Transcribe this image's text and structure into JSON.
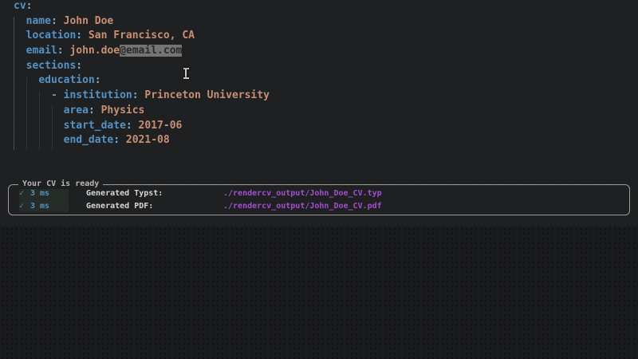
{
  "colors": {
    "key": "#5592c6",
    "colon": "#77b6e0",
    "value": "#c98f74",
    "dash": "#6f93ad",
    "selection_bg": "#737476",
    "selection_text": "#2c2a28",
    "check": "#4f93c2",
    "path": "#a44fd0",
    "background": "#1d1f20",
    "panel_border": "#9c9c9c"
  },
  "icons": {
    "check": "✓",
    "cursor": "i-beam"
  },
  "editor": {
    "lines": [
      {
        "indent": 0,
        "key": "cv",
        "value": ""
      },
      {
        "indent": 1,
        "key": "name",
        "value": "John Doe"
      },
      {
        "indent": 1,
        "key": "location",
        "value": "San Francisco, CA"
      },
      {
        "indent": 1,
        "key": "email",
        "value": "john.doe",
        "selected": "@email.com"
      },
      {
        "indent": 1,
        "key": "sections",
        "value": ""
      },
      {
        "indent": 2,
        "key": "education",
        "value": ""
      },
      {
        "indent": 3,
        "dash": true,
        "key": "institution",
        "value": "Princeton University"
      },
      {
        "indent": 4,
        "key": "area",
        "value": "Physics"
      },
      {
        "indent": 4,
        "key": "start_date",
        "value": "2017-06"
      },
      {
        "indent": 4,
        "key": "end_date",
        "value": "2021-08"
      }
    ]
  },
  "panel": {
    "title": "Your CV is ready",
    "rows": [
      {
        "time": "3 ms",
        "label": "Generated Typst:",
        "path": "./rendercv_output/John_Doe_CV.typ"
      },
      {
        "time": "3 ms",
        "label": "Generated PDF:",
        "path": "./rendercv_output/John_Doe_CV.pdf"
      }
    ]
  }
}
